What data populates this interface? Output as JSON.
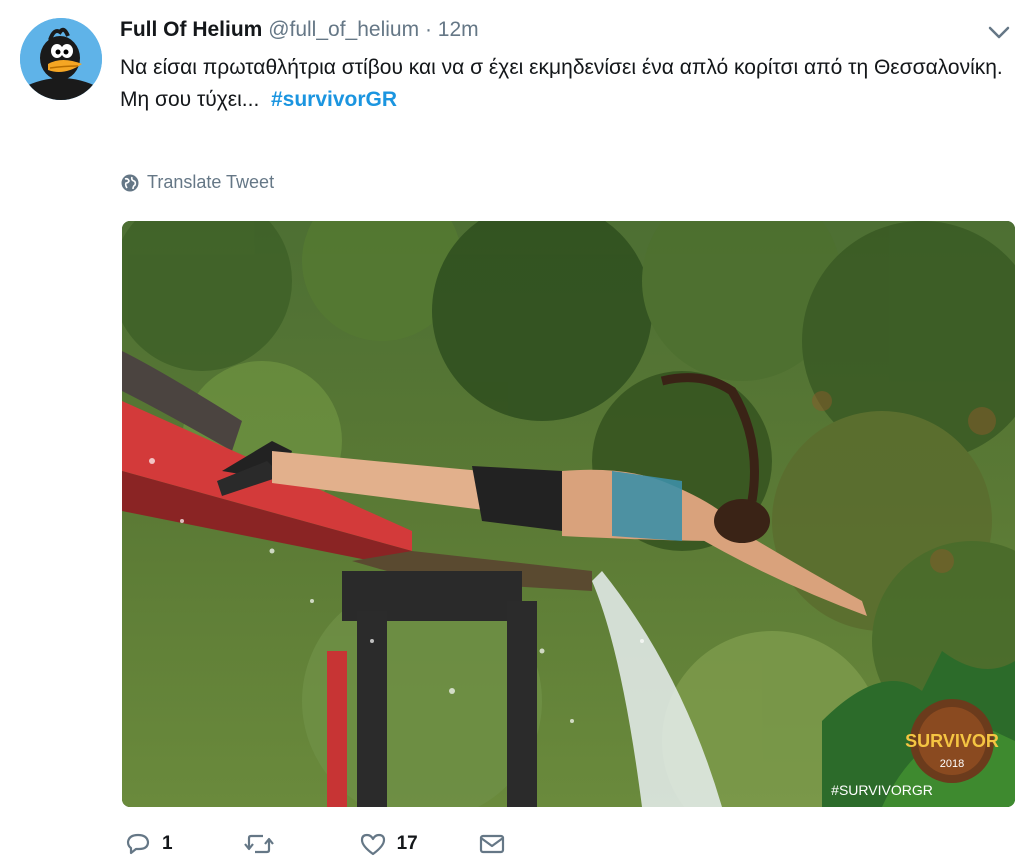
{
  "tweet": {
    "display_name": "Full Of Helium",
    "handle": "@full_of_helium",
    "separator": "·",
    "time": "12m",
    "line1": "Να είσαι πρωταθλήτρια στίβου και να σ έχει εκμηδενίσει ένα απλό κορίτσι από τη Θεσσαλονίκη.",
    "line2_text": "Μη σου τύχει...",
    "hashtag": "#survivorGR",
    "translate_label": "Translate Tweet"
  },
  "media": {
    "logo_text": "SURVIVOR",
    "logo_year": "2018",
    "watermark": "#SURVIVORGR"
  },
  "actions": {
    "reply_count": "1",
    "retweet_count": "",
    "like_count": "17"
  },
  "colors": {
    "link": "#1b95e0",
    "secondary": "#657786",
    "avatar_bg": "#5fb3e8"
  }
}
